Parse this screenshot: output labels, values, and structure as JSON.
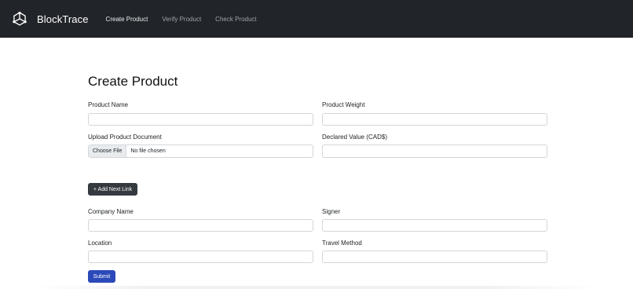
{
  "app": {
    "brand": "BlockTrace",
    "icon": "hexagon-network-logo-icon"
  },
  "nav": {
    "items": [
      "Create Product",
      "Verify Product",
      "Check Product"
    ]
  },
  "page": {
    "title": "Create Product"
  },
  "form": {
    "product_name_label": "Product Name",
    "product_weight_label": "Product Weight",
    "upload_label": "Upload Product Document",
    "file_button": "Choose File",
    "file_status": "No file chosen",
    "declared_value_label": "Declared Value (CAD$)",
    "add_link_button": "+ Add Next Link",
    "company_name_label": "Company Name",
    "signer_label": "Signer",
    "location_label": "Location",
    "travel_method_label": "Travel Method",
    "submit_button": "Submit"
  },
  "colors": {
    "navbar": "#212529",
    "primary": "#2b49b8",
    "dark_button": "#343a40"
  }
}
